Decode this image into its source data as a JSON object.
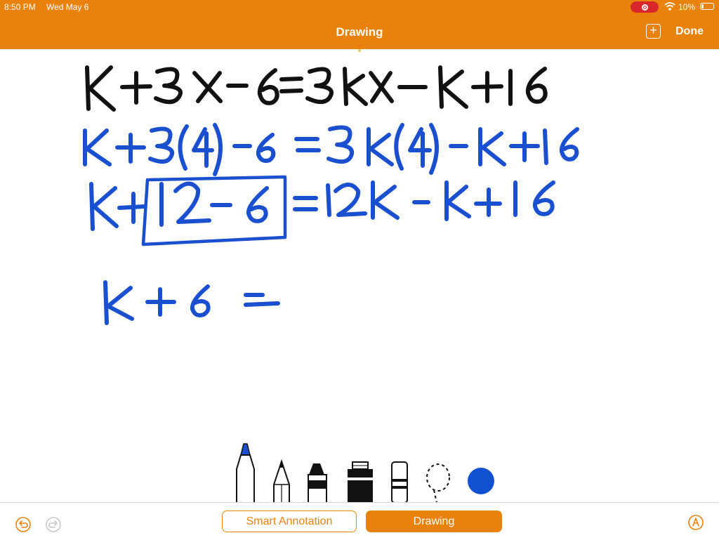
{
  "status_bar": {
    "time": "8:50 PM",
    "date": "Wed May 6",
    "battery": "10%"
  },
  "header": {
    "title": "Drawing",
    "add_icon": "plus-square-icon",
    "done_label": "Done",
    "background": "#e8820c"
  },
  "canvas": {
    "lines": [
      {
        "text": "K+3x-6=3Kx-K+16",
        "color": "#000000"
      },
      {
        "text": "K+3(4)-6=3K(4)-K+16",
        "color": "#1a4fd0"
      },
      {
        "text": "K+12-6=12K-K+16",
        "color": "#1a4fd0"
      },
      {
        "text": "K+6=",
        "color": "#1a4fd0"
      }
    ]
  },
  "tools": [
    "marker",
    "pencil",
    "crayon",
    "paint",
    "eraser",
    "lasso",
    "color-swatch"
  ],
  "selected_color": "#1150d0",
  "bottom_bar": {
    "undo_icon": "undo-icon",
    "redo_icon": "redo-icon",
    "smart_annotation_label": "Smart Annotation",
    "drawing_label": "Drawing",
    "pen_icon": "pen-circle-icon"
  }
}
